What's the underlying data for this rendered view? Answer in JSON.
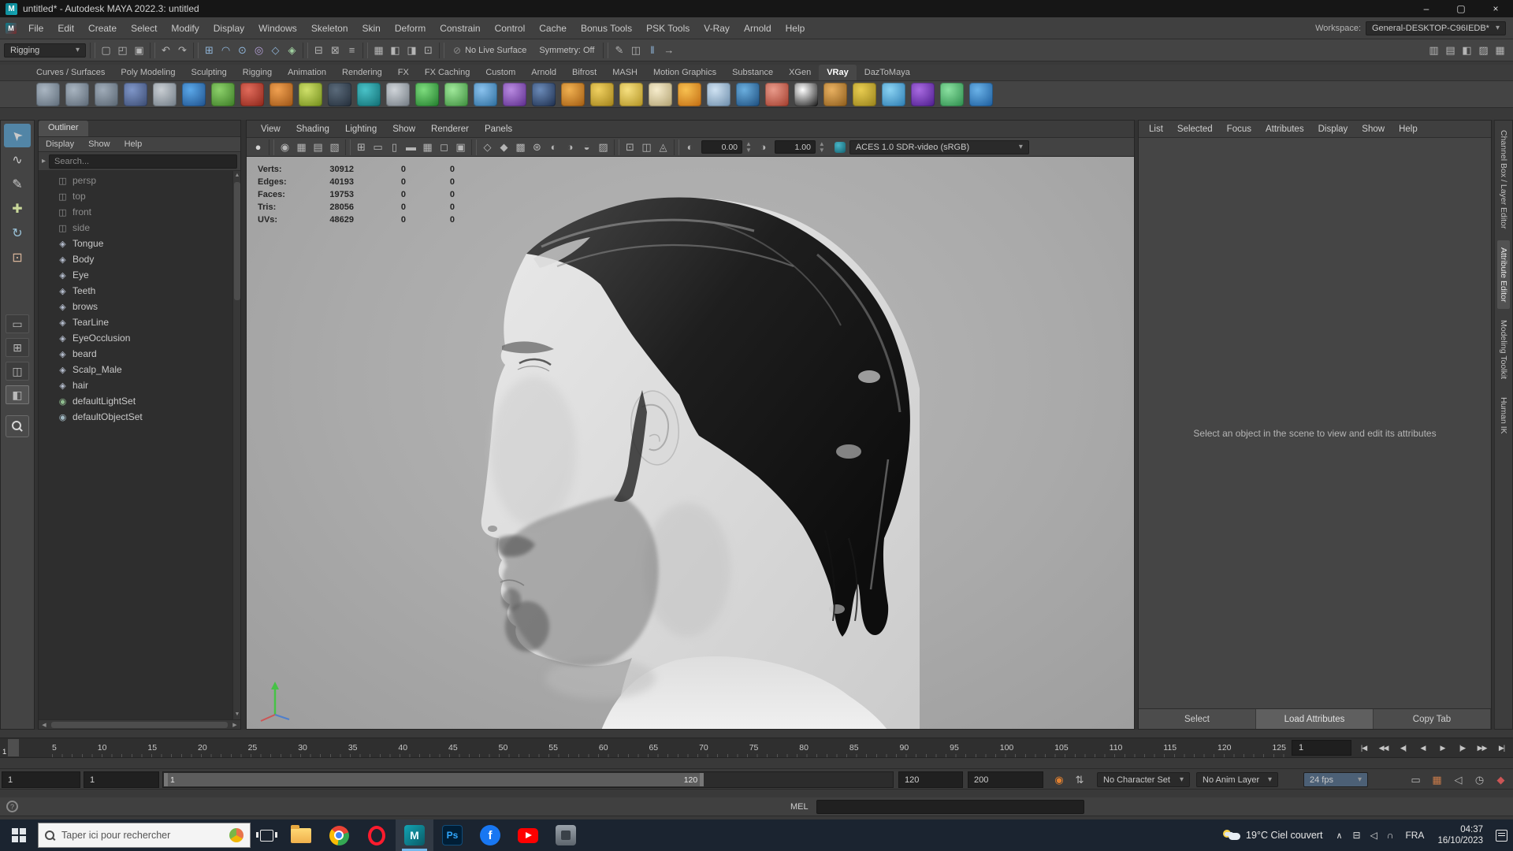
{
  "titlebar": {
    "title": "untitled* - Autodesk MAYA 2022.3: untitled",
    "app_glyph": "M",
    "minimize": "–",
    "restore": "▢",
    "close": "×"
  },
  "menubar": {
    "app_glyph": "M",
    "items": [
      "File",
      "Edit",
      "Create",
      "Select",
      "Modify",
      "Display",
      "Windows",
      "Skeleton",
      "Skin",
      "Deform",
      "Constrain",
      "Control",
      "Cache",
      "Bonus Tools",
      "PSK Tools",
      "V-Ray",
      "Arnold",
      "Help"
    ],
    "workspace_label": "Workspace:",
    "workspace_value": "General-DESKTOP-C96IEDB*"
  },
  "statusline": {
    "mode": "Rigging",
    "left_icons": [
      {
        "name": "separator",
        "div": true
      },
      {
        "name": "new-scene-icon",
        "glyph": "▢"
      },
      {
        "name": "open-scene-icon",
        "glyph": "◰"
      },
      {
        "name": "save-scene-icon",
        "glyph": "▣"
      },
      {
        "name": "separator",
        "div": true
      },
      {
        "name": "undo-icon",
        "glyph": "↶"
      },
      {
        "name": "redo-icon",
        "glyph": "↷"
      },
      {
        "name": "separator",
        "div": true
      },
      {
        "name": "snap-grid-icon",
        "glyph": "⊞",
        "color": "#8fb4d8"
      },
      {
        "name": "snap-curve-icon",
        "glyph": "◠",
        "color": "#8fb4d8"
      },
      {
        "name": "snap-point-icon",
        "glyph": "⊙",
        "color": "#8fb4d8"
      },
      {
        "name": "snap-projected-center-icon",
        "glyph": "◎",
        "color": "#b49fd8"
      },
      {
        "name": "snap-view-plane-icon",
        "glyph": "◇",
        "color": "#8fb4d8"
      },
      {
        "name": "make-live-icon",
        "glyph": "◈",
        "color": "#9fcf9f"
      },
      {
        "name": "separator",
        "div": true
      },
      {
        "name": "input-connections-icon",
        "glyph": "⊟"
      },
      {
        "name": "output-connections-icon",
        "glyph": "⊠"
      },
      {
        "name": "construction-history-icon",
        "glyph": "≡"
      },
      {
        "name": "separator",
        "div": true
      },
      {
        "name": "render-view-icon",
        "glyph": "▦"
      },
      {
        "name": "render-frame-icon",
        "glyph": "◧"
      },
      {
        "name": "ipr-render-icon",
        "glyph": "◨"
      },
      {
        "name": "render-settings-icon",
        "glyph": "⊡"
      },
      {
        "name": "separator",
        "div": true
      }
    ],
    "no_live_icon": "⊘",
    "no_live_surface": "No Live Surface",
    "symmetry": "Symmetry: Off",
    "mid_icons": [
      {
        "name": "separator",
        "div": true
      },
      {
        "name": "grease-pencil-icon",
        "glyph": "✎"
      },
      {
        "name": "camera-bookmark-icon",
        "glyph": "◫"
      },
      {
        "name": "pause-viewport-icon",
        "glyph": "‖",
        "color": "#8fb4d8"
      },
      {
        "name": "interactive-playback-icon",
        "glyph": "→"
      }
    ],
    "right_icons": [
      {
        "name": "modeling-toolkit-toggle-icon",
        "glyph": "▥"
      },
      {
        "name": "hypershade-toggle-icon",
        "glyph": "▤"
      },
      {
        "name": "tool-settings-toggle-icon",
        "glyph": "◧"
      },
      {
        "name": "attribute-editor-toggle-icon",
        "glyph": "▨"
      },
      {
        "name": "channel-box-toggle-icon",
        "glyph": "▦"
      }
    ]
  },
  "shelf": {
    "menu_glyph": "≡",
    "tabs": [
      {
        "label": "Curves / Surfaces"
      },
      {
        "label": "Poly Modeling"
      },
      {
        "label": "Sculpting"
      },
      {
        "label": "Rigging"
      },
      {
        "label": "Animation"
      },
      {
        "label": "Rendering"
      },
      {
        "label": "FX"
      },
      {
        "label": "FX Caching"
      },
      {
        "label": "Custom"
      },
      {
        "label": "Arnold"
      },
      {
        "label": "Bifrost"
      },
      {
        "label": "MASH"
      },
      {
        "label": "Motion Graphics"
      },
      {
        "label": "Substance"
      },
      {
        "label": "XGen"
      },
      {
        "label": "VRay",
        "active": true
      },
      {
        "label": "DazToMaya"
      }
    ],
    "icons": [
      {
        "name": "shelf-poly-sphere-icon",
        "c1": "#aab6c2",
        "c2": "#5d6a77"
      },
      {
        "name": "shelf-poly-cube-icon",
        "c1": "#a8b4c0",
        "c2": "#5a6673"
      },
      {
        "name": "shelf-poly-plane-icon",
        "c1": "#9fabb8",
        "c2": "#57636f"
      },
      {
        "name": "shelf-modeling-panel-icon",
        "c1": "#7f96c8",
        "c2": "#39496f"
      },
      {
        "name": "shelf-notes-icon",
        "c1": "#c8cdd2",
        "c2": "#6f7a84"
      },
      {
        "name": "shelf-sphere-blue-icon",
        "c1": "#5aa7e8",
        "c2": "#1d4f8a"
      },
      {
        "name": "shelf-blob-green-icon",
        "c1": "#8cd06a",
        "c2": "#3a7a24"
      },
      {
        "name": "shelf-sphere-red-icon",
        "c1": "#e06a5a",
        "c2": "#8a2418"
      },
      {
        "name": "shelf-ball-orange-icon",
        "c1": "#f0a050",
        "c2": "#9a5214"
      },
      {
        "name": "shelf-ball-lime-icon",
        "c1": "#cfe06a",
        "c2": "#6f8a18"
      },
      {
        "name": "shelf-checker-dark-icon",
        "c1": "#5a6a7a",
        "c2": "#222c38"
      },
      {
        "name": "shelf-hairball-teal-icon",
        "c1": "#49c2c8",
        "c2": "#0f6b70"
      },
      {
        "name": "shelf-checker-icon",
        "c1": "#cfd4d9",
        "c2": "#707880"
      },
      {
        "name": "shelf-grass-icon",
        "c1": "#7ddc7d",
        "c2": "#1f7a2a"
      },
      {
        "name": "shelf-fluff-green-icon",
        "c1": "#9fe89a",
        "c2": "#3a8a3a"
      },
      {
        "name": "shelf-spikes-blue-icon",
        "c1": "#8ac2ee",
        "c2": "#2a6a9a"
      },
      {
        "name": "shelf-squiggle-purple-icon",
        "c1": "#b88ae0",
        "c2": "#5a2a8a"
      },
      {
        "name": "shelf-sphere-navy-icon",
        "c1": "#6a8ab8",
        "c2": "#1c2c4a"
      },
      {
        "name": "shelf-dome-orange-icon",
        "c1": "#f0b050",
        "c2": "#a05a10"
      },
      {
        "name": "shelf-funnel-yellow-icon",
        "c1": "#f0d060",
        "c2": "#a08018"
      },
      {
        "name": "shelf-sphere-yellow-icon",
        "c1": "#f6e080",
        "c2": "#b09020"
      },
      {
        "name": "shelf-cone-cream-icon",
        "c1": "#f6eccc",
        "c2": "#b0a070"
      },
      {
        "name": "shelf-burst-orange-icon",
        "c1": "#f8c050",
        "c2": "#c06a10"
      },
      {
        "name": "shelf-panel-lightblue-icon",
        "c1": "#cfe2f2",
        "c2": "#6a8aa8"
      },
      {
        "name": "shelf-ocean-icon",
        "c1": "#6aaede",
        "c2": "#1a4a7a"
      },
      {
        "name": "shelf-capsule-red-icon",
        "c1": "#e89a8a",
        "c2": "#a03a2a"
      },
      {
        "name": "shelf-checker-bw-icon",
        "c1": "#ffffff",
        "c2": "#111111"
      },
      {
        "name": "shelf-camera-orange-icon",
        "c1": "#e8b060",
        "c2": "#8a5a1a"
      },
      {
        "name": "shelf-tool-gold-icon",
        "c1": "#e8cc50",
        "c2": "#96801a"
      },
      {
        "name": "shelf-daz-cloud-icon",
        "c1": "#8ad2f2",
        "c2": "#2a7ab0"
      },
      {
        "name": "shelf-vray-icon",
        "c1": "#a86ae0",
        "c2": "#4a1a8a"
      },
      {
        "name": "shelf-multitile-icon",
        "c1": "#8ae0a0",
        "c2": "#2a8a4a"
      },
      {
        "name": "shelf-help-icon",
        "c1": "#6ab2e8",
        "c2": "#1a5a9a"
      }
    ]
  },
  "toolbox": {
    "tools": [
      {
        "name": "select-tool-icon",
        "glyph": "➤",
        "rot": "-135deg",
        "active": true
      },
      {
        "name": "lasso-tool-icon",
        "glyph": "∿"
      },
      {
        "name": "paint-select-tool-icon",
        "glyph": "✎"
      },
      {
        "name": "move-tool-icon",
        "glyph": "✚",
        "color": "#c9d89a"
      },
      {
        "name": "rotate-tool-icon",
        "glyph": "↻",
        "color": "#9ac2d8"
      },
      {
        "name": "scale-tool-icon",
        "glyph": "⊡",
        "color": "#d8b49a"
      }
    ],
    "layouts": [
      {
        "name": "layout-single-pane-icon",
        "glyph": "▭"
      },
      {
        "name": "layout-four-pane-icon",
        "glyph": "⊞"
      },
      {
        "name": "layout-two-pane-icon",
        "glyph": "◫"
      },
      {
        "name": "layout-persp-outliner-icon",
        "glyph": "◧",
        "active": true
      }
    ]
  },
  "outliner": {
    "tab_title": "Outliner",
    "menus": [
      "Display",
      "Show",
      "Help"
    ],
    "search_placeholder": "Search...",
    "fold_glyph": "▸",
    "items": [
      {
        "name": "outliner-item-persp",
        "label": "persp",
        "glyph": "◫",
        "color": "#8d8d8d",
        "muted": true
      },
      {
        "name": "outliner-item-top",
        "label": "top",
        "glyph": "◫",
        "color": "#8d8d8d",
        "muted": true
      },
      {
        "name": "outliner-item-front",
        "label": "front",
        "glyph": "◫",
        "color": "#8d8d8d",
        "muted": true
      },
      {
        "name": "outliner-item-side",
        "label": "side",
        "glyph": "◫",
        "color": "#8d8d8d",
        "muted": true
      },
      {
        "name": "outliner-item-tongue",
        "label": "Tongue",
        "glyph": "◈",
        "color": "#b4bccc"
      },
      {
        "name": "outliner-item-body",
        "label": "Body",
        "glyph": "◈",
        "color": "#b4bccc"
      },
      {
        "name": "outliner-item-eye",
        "label": "Eye",
        "glyph": "◈",
        "color": "#b4bccc"
      },
      {
        "name": "outliner-item-teeth",
        "label": "Teeth",
        "glyph": "◈",
        "color": "#b4bccc"
      },
      {
        "name": "outliner-item-brows",
        "label": "brows",
        "glyph": "◈",
        "color": "#b4bccc"
      },
      {
        "name": "outliner-item-tearline",
        "label": "TearLine",
        "glyph": "◈",
        "color": "#b4bccc"
      },
      {
        "name": "outliner-item-eyeocclusion",
        "label": "EyeOcclusion",
        "glyph": "◈",
        "color": "#b4bccc"
      },
      {
        "name": "outliner-item-beard",
        "label": "beard",
        "glyph": "◈",
        "color": "#b4bccc"
      },
      {
        "name": "outliner-item-scalp-male",
        "label": "Scalp_Male",
        "glyph": "◈",
        "color": "#b4bccc"
      },
      {
        "name": "outliner-item-hair",
        "label": "hair",
        "glyph": "◈",
        "color": "#b4bccc"
      },
      {
        "name": "outliner-item-defaultlightset",
        "label": "defaultLightSet",
        "glyph": "◉",
        "color": "#8fbc8f"
      },
      {
        "name": "outliner-item-defaultobjectset",
        "label": "defaultObjectSet",
        "glyph": "◉",
        "color": "#9fb6c0"
      }
    ]
  },
  "viewport": {
    "menus": [
      "View",
      "Shading",
      "Lighting",
      "Show",
      "Renderer",
      "Panels"
    ],
    "toolbar_icons": [
      {
        "name": "renderer-ball-icon",
        "glyph": "●",
        "color": "#d5d5d5"
      },
      {
        "name": "separator",
        "div": true
      },
      {
        "name": "select-camera-icon",
        "glyph": "◉"
      },
      {
        "name": "camera-attributes-icon",
        "glyph": "▦"
      },
      {
        "name": "bookmark-icon",
        "glyph": "▤"
      },
      {
        "name": "image-plane-icon",
        "glyph": "▧"
      },
      {
        "name": "separator",
        "div": true
      },
      {
        "name": "2d-pan-zoom-icon",
        "glyph": "⊞"
      },
      {
        "name": "film-gate-icon",
        "glyph": "▭"
      },
      {
        "name": "resolution-gate-icon",
        "glyph": "▯"
      },
      {
        "name": "gate-mask-icon",
        "glyph": "▬"
      },
      {
        "name": "field-chart-icon",
        "glyph": "▦"
      },
      {
        "name": "safe-action-icon",
        "glyph": "◻"
      },
      {
        "name": "safe-title-icon",
        "glyph": "▣"
      },
      {
        "name": "separator",
        "div": true
      },
      {
        "name": "wireframe-icon",
        "glyph": "◇"
      },
      {
        "name": "shaded-icon",
        "glyph": "◆"
      },
      {
        "name": "textured-icon",
        "glyph": "▩"
      },
      {
        "name": "use-all-lights-icon",
        "glyph": "⊛"
      },
      {
        "name": "shadows-icon",
        "glyph": "◐"
      },
      {
        "name": "screen-ao-icon",
        "glyph": "◑"
      },
      {
        "name": "motion-blur-icon",
        "glyph": "◒"
      },
      {
        "name": "multisample-icon",
        "glyph": "▨"
      },
      {
        "name": "separator",
        "div": true
      },
      {
        "name": "isolate-select-icon",
        "glyph": "⊡"
      },
      {
        "name": "xray-icon",
        "glyph": "◫"
      },
      {
        "name": "joints-xray-icon",
        "glyph": "◬"
      },
      {
        "name": "separator",
        "div": true
      }
    ],
    "exposure_icon": "◐",
    "exposure": "0.00",
    "gamma_icon": "◑",
    "gamma": "1.00",
    "colorspace": "ACES 1.0 SDR-video (sRGB)",
    "hud_rows": [
      {
        "label": "Verts:",
        "value": "30912",
        "a": "0",
        "b": "0"
      },
      {
        "label": "Edges:",
        "value": "40193",
        "a": "0",
        "b": "0"
      },
      {
        "label": "Faces:",
        "value": "19753",
        "a": "0",
        "b": "0"
      },
      {
        "label": "Tris:",
        "value": "28056",
        "a": "0",
        "b": "0"
      },
      {
        "label": "UVs:",
        "value": "48629",
        "a": "0",
        "b": "0"
      }
    ]
  },
  "attribute_editor": {
    "menus": [
      "List",
      "Selected",
      "Focus",
      "Attributes",
      "Display",
      "Show",
      "Help"
    ],
    "message": "Select an object in the scene to view and edit its attributes",
    "buttons": [
      {
        "name": "select-button",
        "label": "Select"
      },
      {
        "name": "load-attributes-button",
        "label": "Load Attributes",
        "raised": true
      },
      {
        "name": "copy-tab-button",
        "label": "Copy Tab",
        "dim": true
      }
    ]
  },
  "side_tabs": [
    {
      "name": "tab-channel-box-layer-editor",
      "label": "Channel Box / Layer Editor"
    },
    {
      "name": "tab-attribute-editor",
      "label": "Attribute Editor",
      "active": true
    },
    {
      "name": "tab-modeling-toolkit",
      "label": "Modeling Toolkit"
    },
    {
      "name": "tab-human-ik",
      "label": "Human IK"
    }
  ],
  "timeline": {
    "current_frame": "1",
    "ticks": [
      5,
      10,
      15,
      20,
      25,
      30,
      35,
      40,
      45,
      50,
      55,
      60,
      65,
      70,
      75,
      80,
      85,
      90,
      95,
      100,
      105,
      110,
      115,
      120,
      125
    ],
    "frame_field": "1",
    "transport": [
      {
        "name": "go-to-start-button",
        "glyph": "|◀"
      },
      {
        "name": "step-back-frame-button",
        "glyph": "◀◀"
      },
      {
        "name": "step-back-key-button",
        "glyph": "◀|"
      },
      {
        "name": "play-backwards-button",
        "glyph": "◀"
      },
      {
        "name": "play-forwards-button",
        "glyph": "▶"
      },
      {
        "name": "step-forward-key-button",
        "glyph": "|▶"
      },
      {
        "name": "step-forward-frame-button",
        "glyph": "▶▶"
      },
      {
        "name": "go-to-end-button",
        "glyph": "▶|"
      }
    ]
  },
  "range_slider": {
    "playback_start": "1",
    "anim_start": "1",
    "range_label_start": "1",
    "range_label_end": "120",
    "playback_end": "120",
    "anim_end": "200",
    "character_set_icon": "◉",
    "spinner_icon": "⇅",
    "character_set": "No Character Set",
    "anim_layer": "No Anim Layer",
    "fps": "24 fps",
    "right_icons": [
      {
        "name": "script-editor-icon",
        "glyph": "▭"
      },
      {
        "name": "render-view-shortcut-icon",
        "glyph": "▦",
        "color": "#c97b4a"
      },
      {
        "name": "mute-sounds-icon",
        "glyph": "◁"
      },
      {
        "name": "recent-commands-icon",
        "glyph": "◷"
      },
      {
        "name": "auto-key-icon",
        "glyph": "◆",
        "color": "#cc5555"
      }
    ]
  },
  "command_line": {
    "help_glyph": "?",
    "mel_label": "MEL"
  },
  "taskbar": {
    "search_placeholder": "Taper ici pour rechercher",
    "maya_glyph": "M",
    "ps_label": "Ps",
    "fb_glyph": "f",
    "weather": "19°C Ciel couvert",
    "tray_icons": [
      {
        "name": "display-tray-icon",
        "glyph": "⊟"
      },
      {
        "name": "volume-tray-icon",
        "glyph": "◁"
      },
      {
        "name": "network-tray-icon",
        "glyph": "∩"
      }
    ],
    "language": "FRA",
    "time": "04:37",
    "date": "16/10/2023"
  }
}
